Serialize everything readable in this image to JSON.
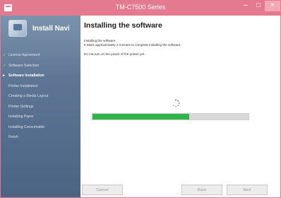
{
  "window": {
    "title": "TM-C7500 Series",
    "minimize": "–",
    "maximize": "□",
    "close": "×"
  },
  "sidebar": {
    "title": "Install Navi",
    "steps": [
      {
        "label": "License Agreement",
        "mark": "✔",
        "state": "done"
      },
      {
        "label": "Software Selection",
        "mark": "✔",
        "state": "done"
      },
      {
        "label": "Software Installation",
        "mark": "▸",
        "state": "current"
      },
      {
        "label": "Printer Installation",
        "mark": "",
        "state": "pending"
      },
      {
        "label": "Creating a Media Layout",
        "mark": "",
        "state": "pending"
      },
      {
        "label": "Printer Settings",
        "mark": "",
        "state": "pending"
      },
      {
        "label": "Installing Paper",
        "mark": "",
        "state": "pending"
      },
      {
        "label": "Installing Consumable",
        "mark": "",
        "state": "pending"
      },
      {
        "label": "Finish",
        "mark": "",
        "state": "pending"
      }
    ]
  },
  "main": {
    "heading": "Installing the software",
    "line1": "Installing the software.",
    "line2": "It takes approximately 2 minutes to complete installing the software.",
    "line3": "Do not turn on the power of the printer yet.",
    "progress_percent": 62
  },
  "buttons": {
    "cancel": "Cancel",
    "back": "Back",
    "next": "Next"
  },
  "colors": {
    "accent": "#e37a90",
    "progress": "#2fb54a",
    "sidebar": "#5e7694"
  }
}
